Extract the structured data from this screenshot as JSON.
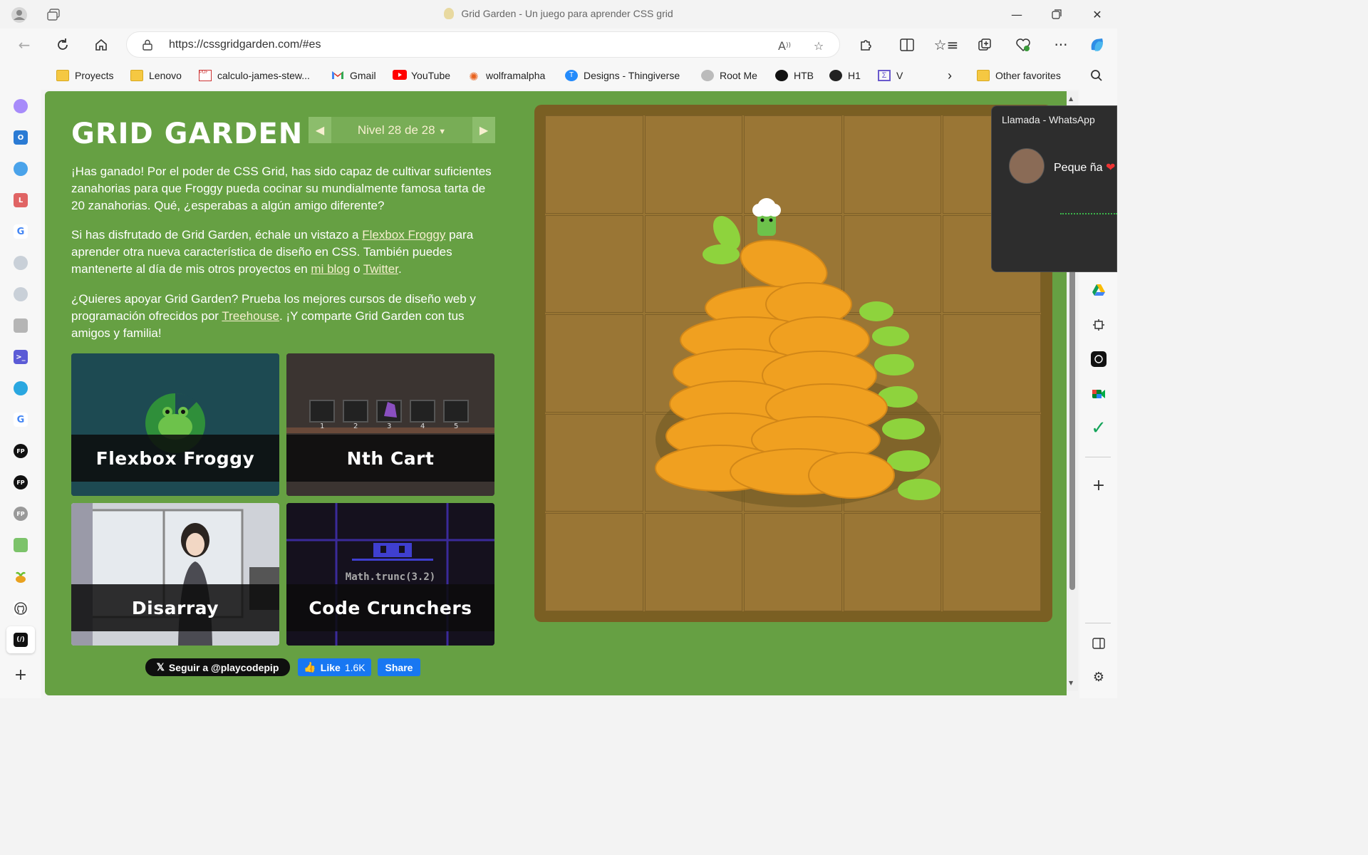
{
  "browser": {
    "window_title": "Grid Garden - Un juego para aprender CSS grid",
    "url": "https://cssgridgarden.com/#es",
    "favorites": [
      {
        "label": "Proyects",
        "icon": "folder-icon"
      },
      {
        "label": "Lenovo",
        "icon": "folder-icon"
      },
      {
        "label": "calculo-james-stew...",
        "icon": "pdf-icon"
      },
      {
        "label": "Gmail",
        "icon": "gmail-icon"
      },
      {
        "label": "YouTube",
        "icon": "youtube-icon"
      },
      {
        "label": "wolframalpha",
        "icon": "wolframalpha-icon"
      },
      {
        "label": "Designs - Thingiverse",
        "icon": "thingiverse-icon"
      },
      {
        "label": "Root Me",
        "icon": "rootme-icon"
      },
      {
        "label": "HTB",
        "icon": "htb-icon"
      },
      {
        "label": "H1",
        "icon": "hackerone-icon"
      },
      {
        "label": "V",
        "icon": "v-icon"
      }
    ],
    "other_favorites": "Other favorites"
  },
  "page": {
    "title": "GRID GARDEN",
    "level_label": "Nivel 28 de 28",
    "p1": "¡Has ganado! Por el poder de CSS Grid, has sido capaz de cultivar suficientes zanahorias para que Froggy pueda cocinar su mundialmente famosa tarta de 20 zanahorias. Qué, ¿esperabas a algún amigo diferente?",
    "p2": {
      "t1": "Si has disfrutado de Grid Garden, échale un vistazo a ",
      "link1": "Flexbox Froggy",
      "t2": " para aprender otra nueva característica de diseño en CSS. También puedes mantenerte al día de mis otros proyectos en ",
      "link2": "mi blog",
      "t3": " o ",
      "link3": "Twitter",
      "t4": "."
    },
    "p3": {
      "t1": "¿Quieres apoyar Grid Garden? Prueba los mejores cursos de diseño web y programación ofrecidos por ",
      "link1": "Treehouse",
      "t2": ". ¡Y comparte Grid Garden con tus amigos y familia!"
    },
    "cards": [
      {
        "title": "Flexbox Froggy"
      },
      {
        "title": "Nth Cart",
        "carts": [
          "1",
          "2",
          "3",
          "4",
          "5"
        ]
      },
      {
        "title": "Disarray"
      },
      {
        "title": "Code Crunchers",
        "code": "Math.trunc(3.2)"
      }
    ],
    "social": {
      "follow": "Seguir a @playcodepip",
      "like": "Like",
      "like_count": "1.6K",
      "share": "Share"
    }
  },
  "whatsapp": {
    "title": "Llamada - WhatsApp",
    "caller": "Peque ña"
  },
  "colors": {
    "page_green": "#66a043",
    "carrot_orange": "#f0a020",
    "leaf_green": "#8ed33d",
    "soil": "#987533"
  }
}
